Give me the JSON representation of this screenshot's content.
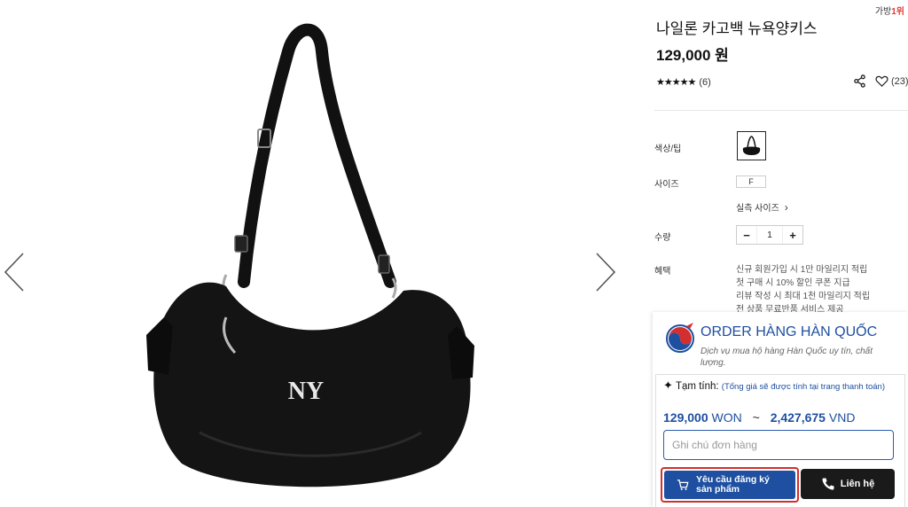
{
  "header": {
    "rank_text": "가방",
    "rank_num": "1위"
  },
  "gallery": {
    "prev_arrow": "chevron-left-icon",
    "next_arrow": "chevron-right-icon"
  },
  "product": {
    "title": "나일론 카고백 뉴욕양키스",
    "price": "129,000 원",
    "stars": "★★★★★",
    "review_count": "(6)",
    "like_count": "(23)"
  },
  "options": {
    "color_label": "색상/팁",
    "size_label": "사이즈",
    "size_value": "F",
    "size_guide": "실측 사이즈",
    "qty_label": "수량",
    "qty_minus": "−",
    "qty_value": "1",
    "qty_plus": "+",
    "benefit_label": "혜택",
    "benefits": [
      "신규 회원가입 시 1만 마일리지 적립",
      "첫 구매 시 10% 할인 쿠폰 지급",
      "리뷰 작성 시 최대 1천 마일리지 적립",
      "전 상품 무료반품 서비스 제공"
    ]
  },
  "order_panel": {
    "title": "ORDER HÀNG HÀN QUỐC",
    "desc": "Dịch vụ mua hộ hàng Hàn Quốc uy tín, chất lượng.",
    "est_label": "Tạm tính:",
    "est_note": "(Tổng giá sẽ được tính tại trang thanh toán)",
    "won_amount": "129,000",
    "won_unit": "WON",
    "tilde": "~",
    "vnd_amount": "2,427,675",
    "vnd_unit": "VND",
    "note_placeholder": "Ghi chú đơn hàng",
    "request_button_line1": "Yêu cầu đăng ký",
    "request_button_line2": "sản phẩm",
    "contact_button": "Liên hệ",
    "colors": {
      "primary": "#1e4fa0",
      "highlight": "#d32f2f",
      "dark": "#1a1a1a"
    }
  }
}
